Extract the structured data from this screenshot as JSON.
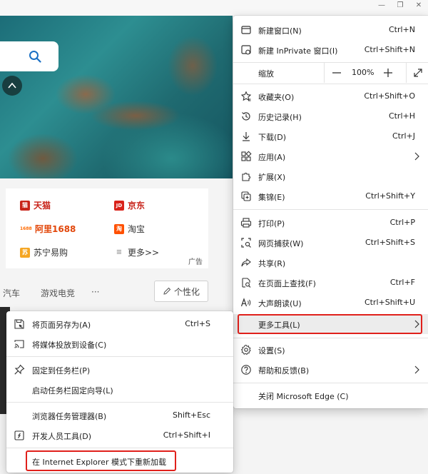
{
  "window": {
    "controls": {
      "minimize": "—",
      "restore": "❐",
      "close": "✕"
    }
  },
  "background": {
    "shops": [
      {
        "name": "天猫",
        "logo": "猫",
        "logo_color": "#c8241a",
        "style": "red"
      },
      {
        "name": "京东",
        "logo": "JD",
        "logo_color": "#d9221a",
        "style": "red"
      },
      {
        "name": "阿里1688",
        "logo": "1688",
        "logo_color": "#ff6a00",
        "style": "red"
      },
      {
        "name": "淘宝",
        "logo": "淘",
        "logo_color": "#ff5000",
        "style": "plain"
      },
      {
        "name": "苏宁易购",
        "logo": "苏",
        "logo_color": "#f5a623",
        "style": "plain"
      },
      {
        "name": "更多>>",
        "logo": "≡",
        "logo_color": "#b0b0b0",
        "style": "plain"
      }
    ],
    "ad_label": "广告",
    "categories": [
      "汽车",
      "游戏电竞",
      "···"
    ],
    "personalize_label": "个性化"
  },
  "main_menu": {
    "items": [
      {
        "label": "新建窗口(N)",
        "shortcut": "Ctrl+N",
        "icon": "new-window-icon"
      },
      {
        "label": "新建 InPrivate 窗口(I)",
        "shortcut": "Ctrl+Shift+N",
        "icon": "inprivate-icon"
      },
      {
        "label": "收藏夹(O)",
        "shortcut": "Ctrl+Shift+O",
        "icon": "favorites-icon"
      },
      {
        "label": "历史记录(H)",
        "shortcut": "Ctrl+H",
        "icon": "history-icon"
      },
      {
        "label": "下载(D)",
        "shortcut": "Ctrl+J",
        "icon": "download-icon"
      },
      {
        "label": "应用(A)",
        "shortcut": "",
        "icon": "apps-icon",
        "submenu": true
      },
      {
        "label": "扩展(X)",
        "shortcut": "",
        "icon": "extensions-icon"
      },
      {
        "label": "集锦(E)",
        "shortcut": "Ctrl+Shift+Y",
        "icon": "collections-icon"
      },
      {
        "label": "打印(P)",
        "shortcut": "Ctrl+P",
        "icon": "print-icon"
      },
      {
        "label": "网页捕获(W)",
        "shortcut": "Ctrl+Shift+S",
        "icon": "web-capture-icon"
      },
      {
        "label": "共享(R)",
        "shortcut": "",
        "icon": "share-icon"
      },
      {
        "label": "在页面上查找(F)",
        "shortcut": "Ctrl+F",
        "icon": "find-icon"
      },
      {
        "label": "大声朗读(U)",
        "shortcut": "Ctrl+Shift+U",
        "icon": "read-aloud-icon"
      },
      {
        "label": "更多工具(L)",
        "shortcut": "",
        "icon": "",
        "submenu": true,
        "highlighted": true
      },
      {
        "label": "设置(S)",
        "shortcut": "",
        "icon": "settings-icon"
      },
      {
        "label": "帮助和反馈(B)",
        "shortcut": "",
        "icon": "help-icon",
        "submenu": true
      },
      {
        "label": "关闭 Microsoft Edge (C)",
        "shortcut": "",
        "icon": ""
      }
    ],
    "zoom": {
      "label": "缩放",
      "value": "100%"
    }
  },
  "more_tools_menu": {
    "items": [
      {
        "label": "将页面另存为(A)",
        "shortcut": "Ctrl+S",
        "icon": "save-page-icon"
      },
      {
        "label": "将媒体投放到设备(C)",
        "shortcut": "",
        "icon": "cast-icon"
      },
      {
        "label": "固定到任务栏(P)",
        "shortcut": "",
        "icon": "pin-icon"
      },
      {
        "label": "启动任务栏固定向导(L)",
        "shortcut": "",
        "icon": ""
      },
      {
        "label": "浏览器任务管理器(B)",
        "shortcut": "Shift+Esc",
        "icon": ""
      },
      {
        "label": "开发人员工具(D)",
        "shortcut": "Ctrl+Shift+I",
        "icon": "dev-tools-icon"
      },
      {
        "label": "在 Internet Explorer 模式下重新加载",
        "shortcut": "",
        "icon": ""
      }
    ]
  },
  "colors": {
    "highlight_box": "#e0201b",
    "accent_blue": "#1a6fc4"
  }
}
